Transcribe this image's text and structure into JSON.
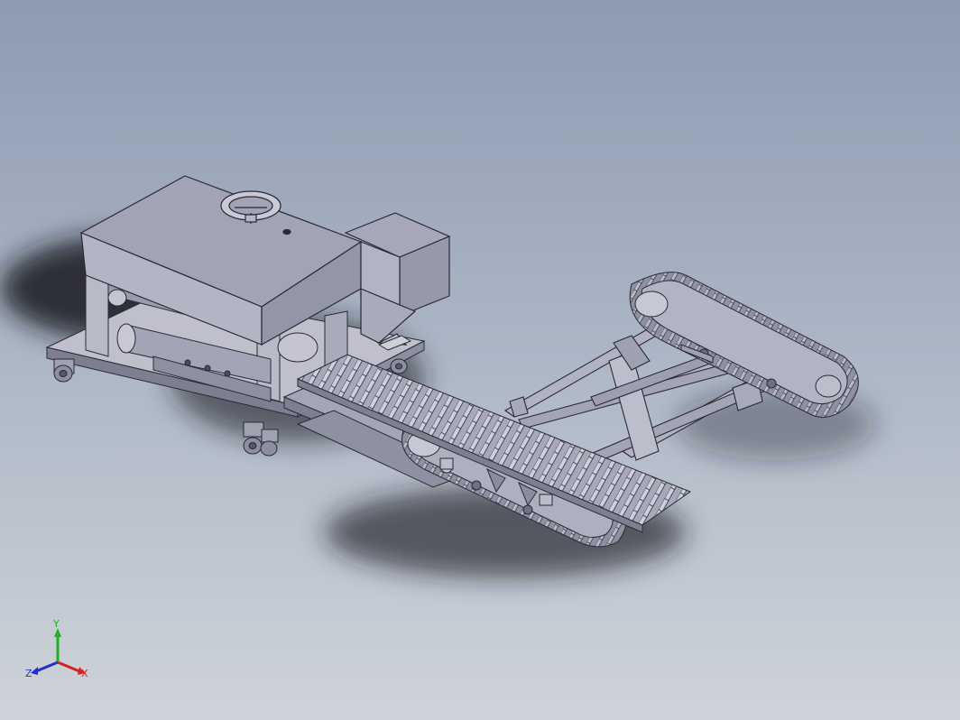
{
  "viewport": {
    "background_top": "#8e9bb0",
    "background_bottom": "#cfd3d9",
    "model_color": "#9ea0b2",
    "model_edge_color": "#2a2a35"
  },
  "triad": {
    "x_label": "X",
    "y_label": "Y",
    "z_label": "Z",
    "x_color": "#d42020",
    "y_color": "#22b022",
    "z_color": "#2030c8"
  }
}
